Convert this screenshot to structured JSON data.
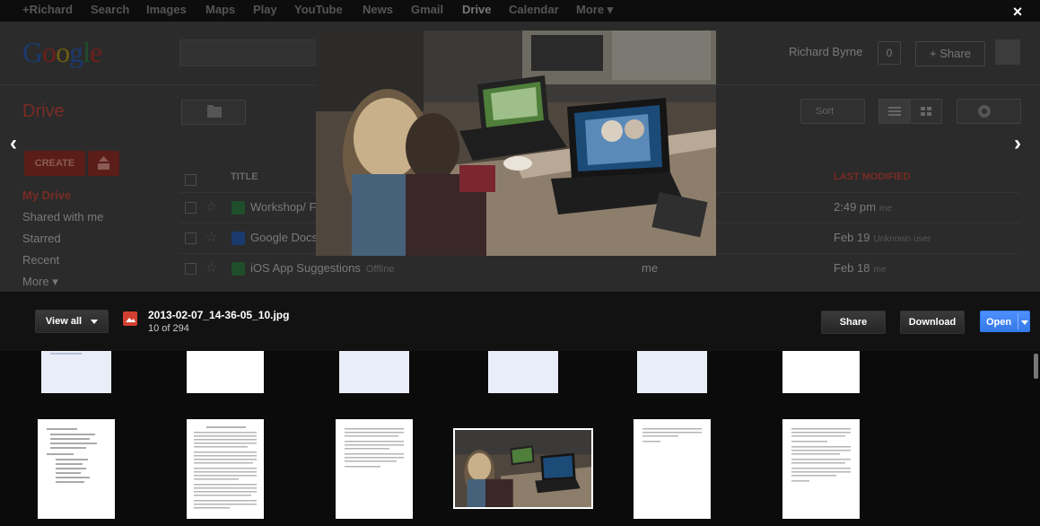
{
  "google_bar": {
    "items": [
      "+Richard",
      "Search",
      "Images",
      "Maps",
      "Play",
      "YouTube",
      "News",
      "Gmail",
      "Drive",
      "Calendar",
      "More ▾"
    ]
  },
  "header": {
    "logo": "Google",
    "user_name": "Richard Byrne",
    "notification_count": "0",
    "share_label": "+ Share"
  },
  "drive": {
    "title": "Drive",
    "create_label": "CREATE",
    "sort_label": "Sort",
    "nav": [
      "My Drive",
      "Shared with me",
      "Starred",
      "Recent",
      "More ▾"
    ],
    "columns": {
      "title": "TITLE",
      "last_modified": "LAST MODIFIED"
    },
    "files": [
      {
        "name": "Workshop/ F",
        "sub": "",
        "owner": "",
        "date": "2:49 pm",
        "date_by": "me",
        "icon_color": "#1f4e2b"
      },
      {
        "name": "Google Docs",
        "sub": "",
        "owner": "",
        "date": "Feb 19",
        "date_by": "Unknown user",
        "icon_color": "#1b3a6e"
      },
      {
        "name": "iOS App Suggestions",
        "sub": "Offline",
        "owner": "me",
        "date": "Feb 18",
        "date_by": "me",
        "icon_color": "#1f4e2b"
      }
    ]
  },
  "viewer": {
    "close_icon": "×",
    "prev_icon": "‹",
    "next_icon": "›",
    "view_all_label": "View all",
    "file_name": "2013-02-07_14-36-05_10.jpg",
    "file_position": "10 of 294",
    "share_label": "Share",
    "download_label": "Download",
    "open_label": "Open"
  }
}
